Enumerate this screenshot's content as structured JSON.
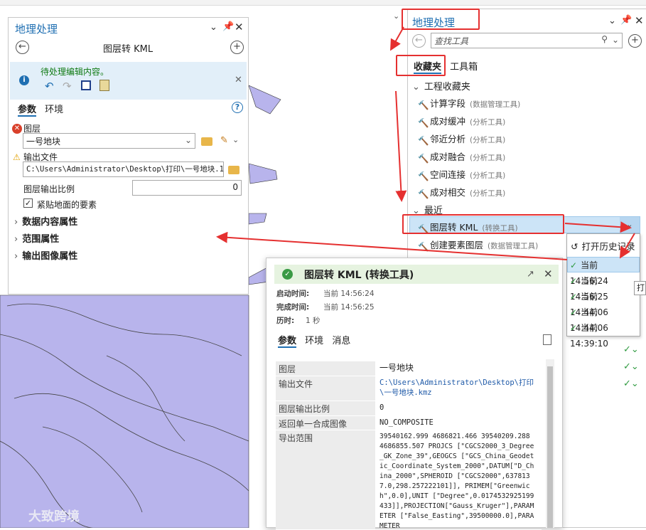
{
  "left_panel": {
    "title": "地理处理",
    "tool_name": "图层转 KML",
    "message": "待处理编辑内容。",
    "tabs": [
      "参数",
      "环境"
    ],
    "param_layer_label": "图层",
    "param_layer_value": "一号地块",
    "param_output_label": "输出文件",
    "param_output_value": "C:\\Users\\Administrator\\Desktop\\打印\\一号地块.1",
    "param_scale_label": "图层输出比例",
    "param_scale_value": "0",
    "checkbox_label": "紧贴地面的要素",
    "checkbox_checked": true,
    "sections": [
      "数据内容属性",
      "范围属性",
      "输出图像属性"
    ]
  },
  "right_panel": {
    "title": "地理处理",
    "search_placeholder": "查找工具",
    "tabs": [
      "收藏夹",
      "工具箱"
    ],
    "group_project": "工程收藏夹",
    "project_tools": [
      {
        "name": "计算字段",
        "source": "(数据管理工具)"
      },
      {
        "name": "成对缓冲",
        "source": "(分析工具)"
      },
      {
        "name": "邻近分析",
        "source": "(分析工具)"
      },
      {
        "name": "成对融合",
        "source": "(分析工具)"
      },
      {
        "name": "空间连接",
        "source": "(分析工具)"
      },
      {
        "name": "成对相交",
        "source": "(分析工具)"
      }
    ],
    "group_recent": "最近",
    "recent_tools": [
      {
        "name": "图层转 KML",
        "source": "(转换工具)"
      },
      {
        "name": "创建要素图层",
        "source": "(数据管理工具)"
      }
    ]
  },
  "history_menu": {
    "header": "打开历史记录",
    "items": [
      "当前 14:56:24",
      "当前 14:56:25",
      "当前 14:44:06",
      "当前 14:44:06",
      "当前 14:39:10"
    ],
    "tooltip": "打"
  },
  "details_panel": {
    "title": "图层转 KML (转换工具)",
    "start_label": "启动时间:",
    "start_value": "当前 14:56:24",
    "end_label": "完成时间:",
    "end_value": "当前 14:56:25",
    "duration_label": "历时:",
    "duration_value": "1 秒",
    "tabs": [
      "参数",
      "环境",
      "消息"
    ],
    "rows": [
      {
        "label": "图层",
        "value": "一号地块"
      },
      {
        "label": "输出文件",
        "value": "C:\\Users\\Administrator\\Desktop\\打印\\一号地块.kmz"
      },
      {
        "label": "图层输出比例",
        "value": "0"
      },
      {
        "label": "返回单一合成图像",
        "value": "NO_COMPOSITE"
      },
      {
        "label": "导出范围",
        "value": "39540162.999 4686821.466 39540209.288 4686855.507 PROJCS [\"CGCS2000_3_Degree_GK_Zone_39\",GEOGCS [\"GCS_China_Geodetic_Coordinate_System_2000\",DATUM[\"D_China_2000\",SPHEROID [\"CGCS2000\",6378137.0,298.257222101]], PRIMEM[\"Greenwich\",0.0],UNIT [\"Degree\",0.0174532925199433]],PROJECTION[\"Gauss_Kruger\"],PARAMETER [\"False_Easting\",39500000.0],PARAMETER"
      }
    ]
  },
  "watermark": "大致跨境",
  "colors": {
    "map_fill": "#b8b4ec",
    "accent": "#1f6fb2",
    "highlight": "#cce4f7",
    "annotation": "#e53030"
  }
}
